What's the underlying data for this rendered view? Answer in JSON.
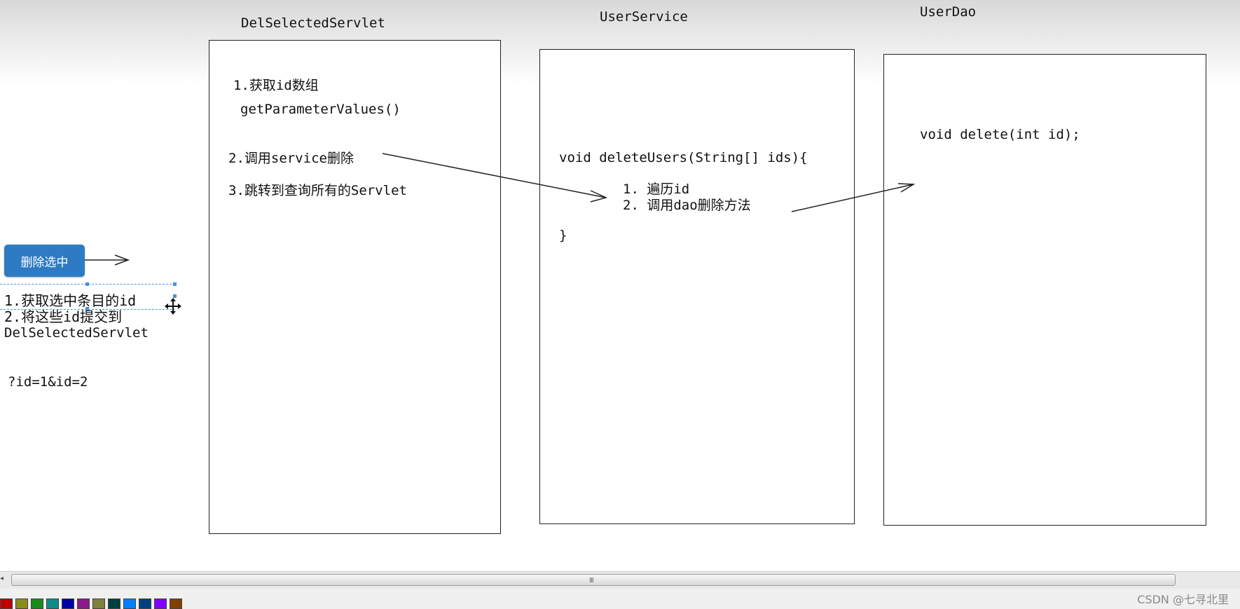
{
  "columns": {
    "servlet_title": "DelSelectedServlet",
    "service_title": "UserService",
    "dao_title": "UserDao"
  },
  "servlet": {
    "step1": "1.获取id数组",
    "step1_method": "getParameterValues()",
    "step2": "2.调用service删除",
    "step3": "3.跳转到查询所有的Servlet"
  },
  "service": {
    "signature": "void deleteUsers(String[] ids){",
    "step1": "1. 遍历id",
    "step2": "2. 调用dao删除方法",
    "close": "}"
  },
  "dao": {
    "signature": "void delete(int id);"
  },
  "client": {
    "button_label": "删除选中",
    "note_line1": "1.获取选中条目的id",
    "note_line2": "2.将这些id提交到",
    "note_line3": "DelSelectedServlet",
    "query_string": "?id=1&id=2"
  },
  "scrollbar": {
    "grip": "III"
  },
  "palette": {
    "colors": [
      "#c00000",
      "#8b8b1a",
      "#1a8b1a",
      "#128a8a",
      "#0000a8",
      "#8b1a8b",
      "#808040",
      "#004040",
      "#0080ff",
      "#004080",
      "#8000ff",
      "#804000"
    ]
  },
  "watermark": "CSDN @七寻北里"
}
